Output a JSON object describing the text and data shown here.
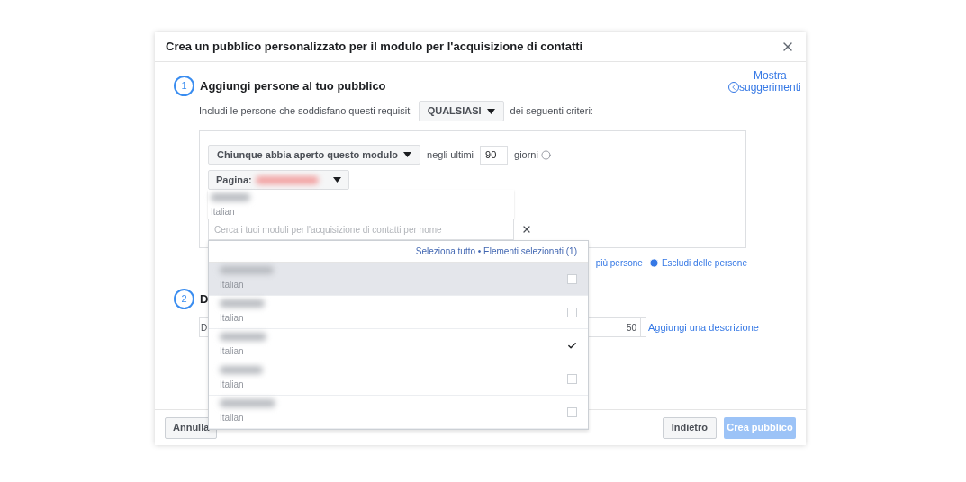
{
  "dialog": {
    "title": "Crea un pubblico personalizzato per il modulo per l'acquisizione di contatti"
  },
  "step1": {
    "number": "1",
    "title": "Aggiungi persone al tuo pubblico",
    "suggestions_link": "Mostra suggerimenti",
    "include_prefix": "Includi le persone che soddisfano questi requisiti",
    "match_select": "QUALSIASI",
    "include_suffix": "dei seguenti criteri:",
    "event_select": "Chiunque abbia aperto questo modulo",
    "in_last_label": "negli ultimi",
    "days": "90",
    "days_unit": "giorni",
    "page_label": "Pagina:",
    "include_more_link": "più persone",
    "exclude_link": "Escludi delle persone"
  },
  "step2": {
    "number": "2",
    "title": "D",
    "name_value": "D",
    "char_count": "50",
    "description_link": "Aggiungi una descrizione"
  },
  "form_picker": {
    "selected_language": "Italian",
    "search_placeholder": "Cerca i tuoi moduli per l'acquisizione di contatti per nome",
    "select_links": "Seleziona tutto • Elementi selezionati (1)",
    "forms": [
      {
        "language": "Italian",
        "checked": false,
        "highlighted": true
      },
      {
        "language": "Italian",
        "checked": false,
        "highlighted": false
      },
      {
        "language": "Italian",
        "checked": true,
        "highlighted": false
      },
      {
        "language": "Italian",
        "checked": false,
        "highlighted": false
      },
      {
        "language": "Italian",
        "checked": false,
        "highlighted": false
      }
    ]
  },
  "footer": {
    "cancel": "Annulla",
    "back": "Indietro",
    "create": "Crea pubblico",
    "create_disabled": true
  }
}
